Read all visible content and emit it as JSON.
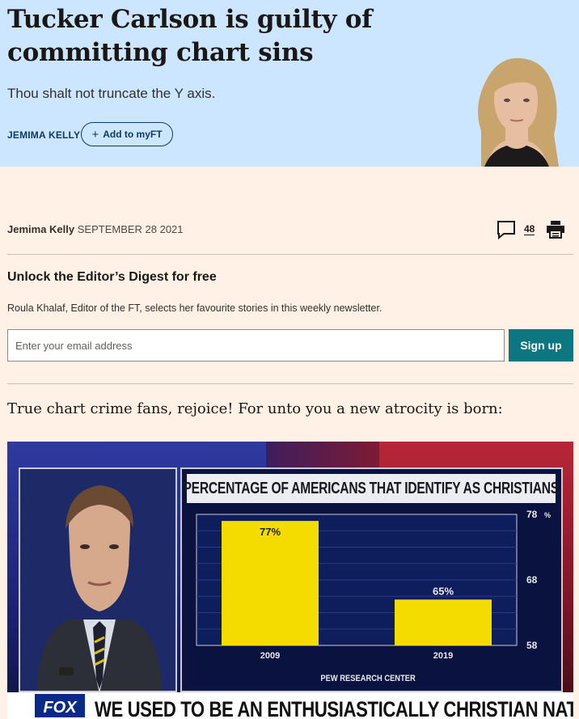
{
  "header": {
    "title": "Tucker Carlson is guilty of committing chart sins",
    "standfirst": "Thou shalt not truncate the Y axis.",
    "byline": "JEMIMA KELLY",
    "myft_button": "Add to myFT",
    "bg_color": "#cce6ff"
  },
  "meta": {
    "author": "Jemima Kelly",
    "date": "SEPTEMBER 28 2021",
    "comment_count": "48"
  },
  "newsletter": {
    "heading": "Unlock the Editor’s Digest for free",
    "description": "Roula Khalaf, Editor of the FT, selects her favourite stories in this weekly newsletter.",
    "email_placeholder": "Enter your email address",
    "signup_label": "Sign up",
    "signup_color": "#0d7680"
  },
  "body": {
    "paragraph": "True chart crime fans, rejoice! For unto you a new atrocity is born:"
  },
  "tv_graphic": {
    "chart_title": "PERCENTAGE OF AMERICANS THAT IDENTIFY AS CHRISTIANS",
    "source": "PEW RESEARCH CENTER",
    "lower_third": "WE USED TO BE AN ENTHUSIASTICALLY CHRISTIAN NATION",
    "network_logo": "FOX"
  },
  "chart_data": {
    "type": "bar",
    "title": "PERCENTAGE OF AMERICANS THAT IDENTIFY AS CHRISTIANS",
    "categories": [
      "2009",
      "2019"
    ],
    "values": [
      77,
      65
    ],
    "value_labels": [
      "77%",
      "65%"
    ],
    "ylim": [
      58,
      78
    ],
    "yticks": [
      58,
      68,
      78
    ],
    "ytick_unit": "%",
    "y_axis_side": "right",
    "bar_color": "#f5dc00",
    "grid": true
  },
  "icons": {
    "comment": "speech-bubble-icon",
    "print": "printer-icon",
    "add": "plus-icon"
  }
}
